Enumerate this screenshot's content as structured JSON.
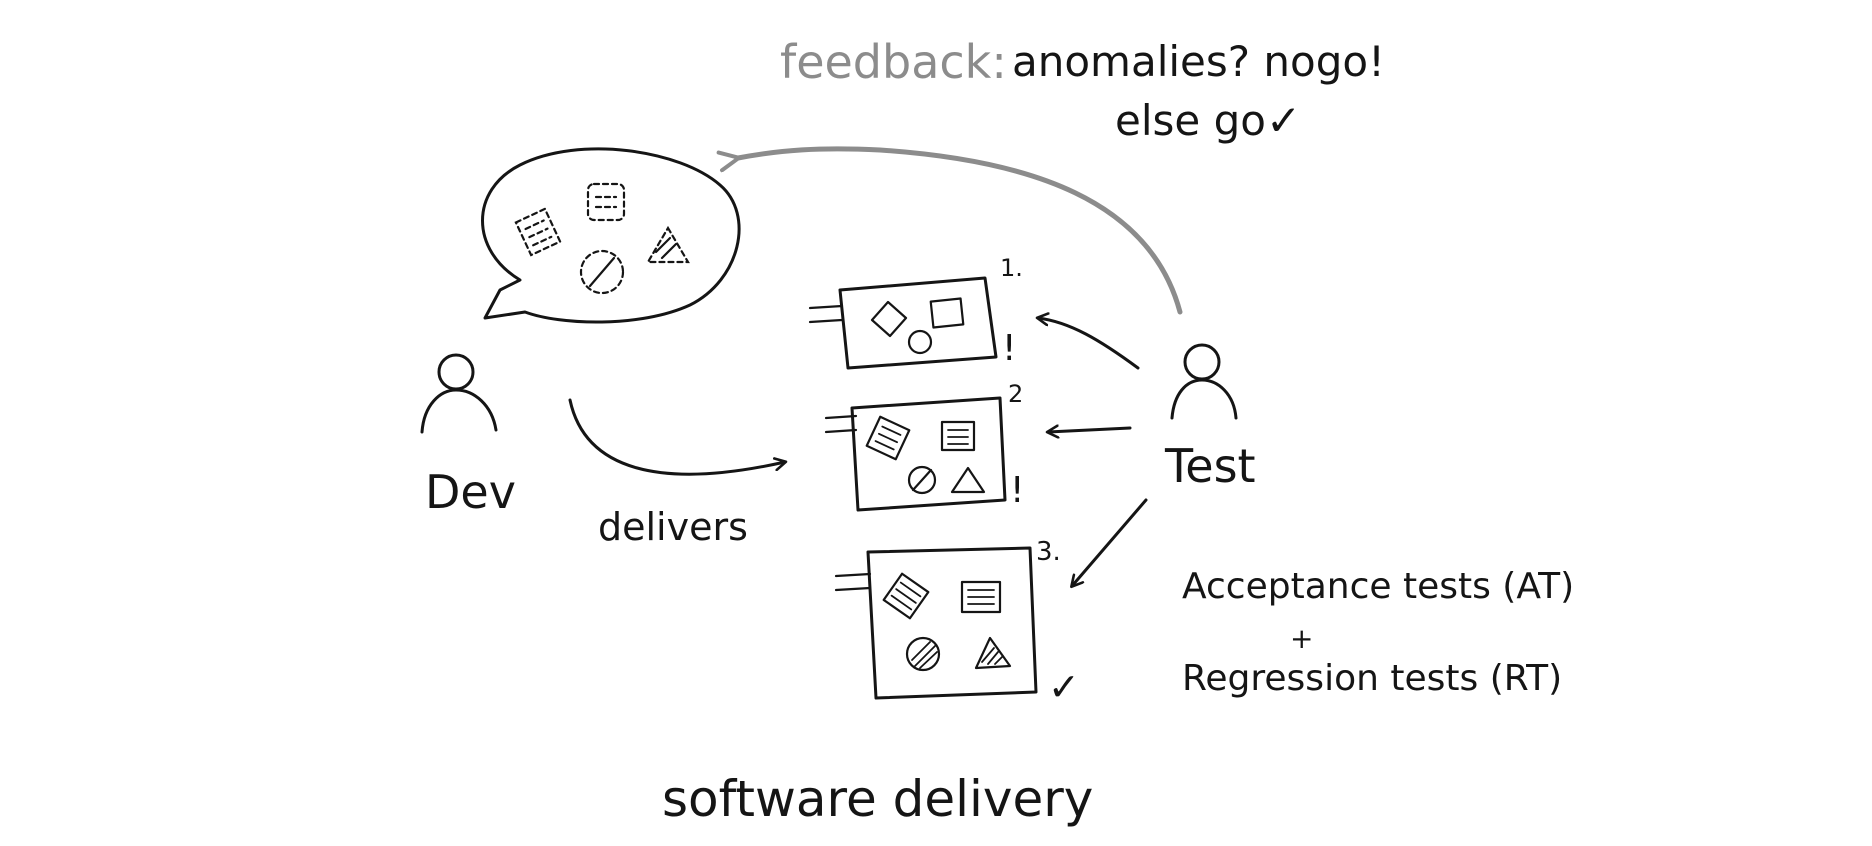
{
  "feedback": {
    "label": "feedback:",
    "line1": "anomalies? nogo!",
    "line2": "else go✓"
  },
  "actors": {
    "dev": "Dev",
    "test": "Test"
  },
  "delivers_label": "delivers",
  "deliveries": [
    {
      "number": "1.",
      "status": "!"
    },
    {
      "number": "2",
      "status": "!"
    },
    {
      "number": "3.",
      "status": "✓"
    }
  ],
  "tests": {
    "acceptance": "Acceptance tests (AT)",
    "plus": "+",
    "regression": "Regression tests (RT)"
  },
  "caption": "software delivery",
  "colors": {
    "ink": "#151515",
    "feedback_arrow": "#8c8c8c"
  }
}
